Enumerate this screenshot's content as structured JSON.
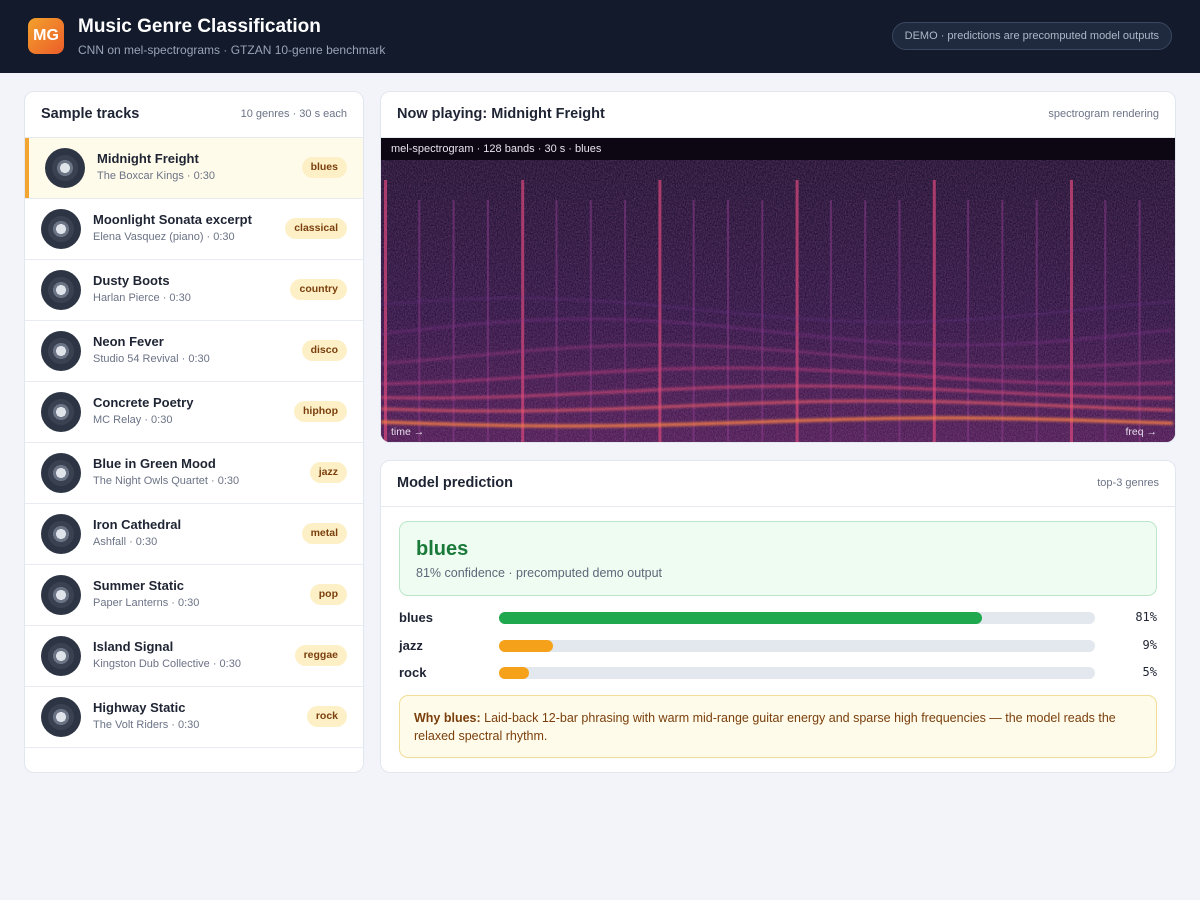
{
  "header": {
    "logo": "MG",
    "title": "Music Genre Classification",
    "subtitle": "CNN on mel-spectrograms · GTZAN 10-genre benchmark",
    "demo_notice": "DEMO · predictions are precomputed model outputs"
  },
  "tracks_panel": {
    "title": "Sample tracks",
    "meta": "10 genres · 30 s each",
    "items": [
      {
        "name": "Midnight Freight",
        "artist": "The Boxcar Kings · 0:30",
        "genre": "blues"
      },
      {
        "name": "Moonlight Sonata excerpt",
        "artist": "Elena Vasquez (piano) · 0:30",
        "genre": "classical"
      },
      {
        "name": "Dusty Boots",
        "artist": "Harlan Pierce · 0:30",
        "genre": "country"
      },
      {
        "name": "Neon Fever",
        "artist": "Studio 54 Revival · 0:30",
        "genre": "disco"
      },
      {
        "name": "Concrete Poetry",
        "artist": "MC Relay · 0:30",
        "genre": "hiphop"
      },
      {
        "name": "Blue in Green Mood",
        "artist": "The Night Owls Quartet · 0:30",
        "genre": "jazz"
      },
      {
        "name": "Iron Cathedral",
        "artist": "Ashfall · 0:30",
        "genre": "metal"
      },
      {
        "name": "Summer Static",
        "artist": "Paper Lanterns · 0:30",
        "genre": "pop"
      },
      {
        "name": "Island Signal",
        "artist": "Kingston Dub Collective · 0:30",
        "genre": "reggae"
      },
      {
        "name": "Highway Static",
        "artist": "The Volt Riders · 0:30",
        "genre": "rock"
      }
    ]
  },
  "player": {
    "title": "Now playing: Midnight Freight",
    "meta": "spectrogram rendering",
    "spectrogram_label": "mel-spectrogram · 128 bands · 30 s · blues",
    "time_axis": "time →",
    "freq_axis": "freq →"
  },
  "prediction": {
    "title": "Model prediction",
    "meta": "top-3 genres",
    "top_genre": "blues",
    "top_confidence": "81% confidence · precomputed demo output",
    "bars": [
      {
        "label": "blues",
        "value": 81,
        "pct": "81%",
        "color": "#1fa84d"
      },
      {
        "label": "jazz",
        "value": 9,
        "pct": "9%",
        "color": "#f5a21a"
      },
      {
        "label": "rock",
        "value": 5,
        "pct": "5%",
        "color": "#f5a21a"
      }
    ],
    "why_label": "Why blues:",
    "why_text": "Laid-back 12-bar phrasing with warm mid-range guitar energy and sparse high frequencies — the model reads the relaxed spectral rhythm."
  }
}
